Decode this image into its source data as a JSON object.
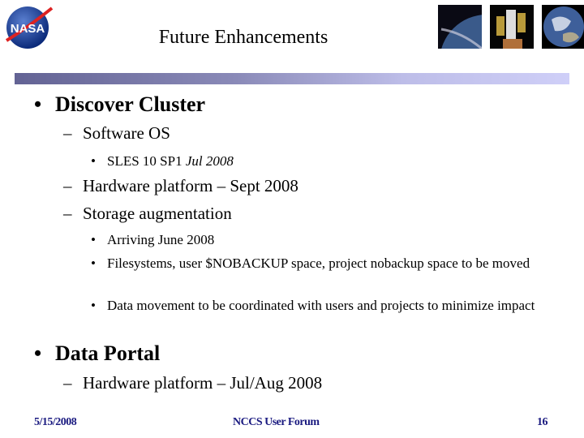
{
  "header": {
    "title": "Future Enhancements",
    "logo": "nasa-logo",
    "thumbnails": [
      "earth-limb-image",
      "hubble-telescope-image",
      "earth-globe-image"
    ]
  },
  "body": {
    "sections": [
      {
        "label": "Discover Cluster",
        "sub1_label": "Software OS",
        "sub1_detail_bold": "SLES 10 SP1",
        "sub1_detail_italic": "Jul 2008",
        "sub2_label": "Hardware platform – Sept 2008",
        "sub3_label": "Storage augmentation",
        "sub3_items": [
          "Arriving June 2008",
          "Filesystems, user $NOBACKUP space, project nobackup space to be moved",
          "Data movement to be coordinated with users and projects to minimize impact"
        ]
      },
      {
        "label": "Data Portal",
        "sub1_label": "Hardware platform – Jul/Aug 2008"
      }
    ],
    "bullet": "•",
    "dash": "–"
  },
  "footer": {
    "date": "5/15/2008",
    "event": "NCCS User Forum",
    "page": "16"
  }
}
